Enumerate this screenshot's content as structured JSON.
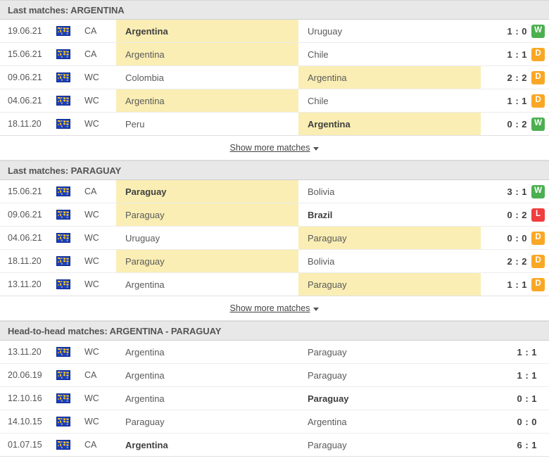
{
  "icons": {
    "competition_icon": "world-map-icon",
    "caret_icon": "chevron-down-icon"
  },
  "colors": {
    "highlight": "#faeeb4",
    "header_bar": "#e8e8e8",
    "win": "#4caf50",
    "draw": "#f9a825",
    "loss": "#f03e3e"
  },
  "show_more": {
    "label": "Show more matches"
  },
  "sections": [
    {
      "id": "last-matches-argentina",
      "title": "Last matches: ARGENTINA",
      "has_badges": true,
      "has_show_more": true,
      "rows": [
        {
          "date": "19.06.21",
          "competition": "CA",
          "home": "Argentina",
          "away": "Uruguay",
          "score": "1 : 0",
          "result": "W",
          "highlight": "home",
          "winner": "home"
        },
        {
          "date": "15.06.21",
          "competition": "CA",
          "home": "Argentina",
          "away": "Chile",
          "score": "1 : 1",
          "result": "D",
          "highlight": "home",
          "winner": "none"
        },
        {
          "date": "09.06.21",
          "competition": "WC",
          "home": "Colombia",
          "away": "Argentina",
          "score": "2 : 2",
          "result": "D",
          "highlight": "away",
          "winner": "none"
        },
        {
          "date": "04.06.21",
          "competition": "WC",
          "home": "Argentina",
          "away": "Chile",
          "score": "1 : 1",
          "result": "D",
          "highlight": "home",
          "winner": "none"
        },
        {
          "date": "18.11.20",
          "competition": "WC",
          "home": "Peru",
          "away": "Argentina",
          "score": "0 : 2",
          "result": "W",
          "highlight": "away",
          "winner": "away"
        }
      ]
    },
    {
      "id": "last-matches-paraguay",
      "title": "Last matches: PARAGUAY",
      "has_badges": true,
      "has_show_more": true,
      "rows": [
        {
          "date": "15.06.21",
          "competition": "CA",
          "home": "Paraguay",
          "away": "Bolivia",
          "score": "3 : 1",
          "result": "W",
          "highlight": "home",
          "winner": "home"
        },
        {
          "date": "09.06.21",
          "competition": "WC",
          "home": "Paraguay",
          "away": "Brazil",
          "score": "0 : 2",
          "result": "L",
          "highlight": "home",
          "winner": "away"
        },
        {
          "date": "04.06.21",
          "competition": "WC",
          "home": "Uruguay",
          "away": "Paraguay",
          "score": "0 : 0",
          "result": "D",
          "highlight": "away",
          "winner": "none"
        },
        {
          "date": "18.11.20",
          "competition": "WC",
          "home": "Paraguay",
          "away": "Bolivia",
          "score": "2 : 2",
          "result": "D",
          "highlight": "home",
          "winner": "none"
        },
        {
          "date": "13.11.20",
          "competition": "WC",
          "home": "Argentina",
          "away": "Paraguay",
          "score": "1 : 1",
          "result": "D",
          "highlight": "away",
          "winner": "none"
        }
      ]
    },
    {
      "id": "head-to-head-argentina-paraguay",
      "title": "Head-to-head matches: ARGENTINA - PARAGUAY",
      "has_badges": false,
      "has_show_more": false,
      "rows": [
        {
          "date": "13.11.20",
          "competition": "WC",
          "home": "Argentina",
          "away": "Paraguay",
          "score": "1 : 1",
          "result": "",
          "highlight": "none",
          "winner": "none"
        },
        {
          "date": "20.06.19",
          "competition": "CA",
          "home": "Argentina",
          "away": "Paraguay",
          "score": "1 : 1",
          "result": "",
          "highlight": "none",
          "winner": "none"
        },
        {
          "date": "12.10.16",
          "competition": "WC",
          "home": "Argentina",
          "away": "Paraguay",
          "score": "0 : 1",
          "result": "",
          "highlight": "none",
          "winner": "away"
        },
        {
          "date": "14.10.15",
          "competition": "WC",
          "home": "Paraguay",
          "away": "Argentina",
          "score": "0 : 0",
          "result": "",
          "highlight": "none",
          "winner": "none"
        },
        {
          "date": "01.07.15",
          "competition": "CA",
          "home": "Argentina",
          "away": "Paraguay",
          "score": "6 : 1",
          "result": "",
          "highlight": "none",
          "winner": "home"
        }
      ]
    }
  ]
}
